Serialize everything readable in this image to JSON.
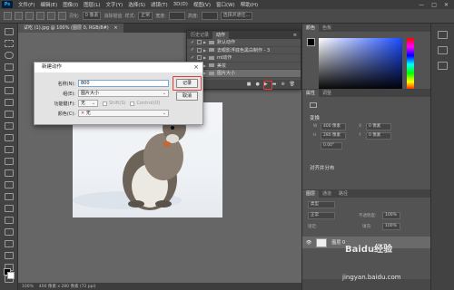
{
  "menu": {
    "logo": "Ps",
    "items": [
      "文件(F)",
      "编辑(E)",
      "图像(I)",
      "图层(L)",
      "文字(Y)",
      "选择(S)",
      "滤镜(T)",
      "3D(D)",
      "视图(V)",
      "窗口(W)",
      "帮助(H)"
    ],
    "minimize": "—",
    "maximize": "□",
    "close": "✕"
  },
  "options": {
    "feather_label": "羽化:",
    "feather_value": "0 像素",
    "antialias_label": "消除锯齿",
    "style_label": "样式:",
    "style_value": "正常",
    "width_label": "宽度:",
    "height_label": "高度:",
    "select_mask": "选择并遮住..."
  },
  "document": {
    "tab_title": "试吃 (1).jpg @ 100% (图层 0, RGB/8#)",
    "tab_close": "×",
    "zoom": "100%",
    "status": "400 像素 x 280 像素 (72 ppi)"
  },
  "dialog": {
    "title": "新建动作",
    "close": "×",
    "name_label": "名称(N):",
    "name_value": "800",
    "set_label": "组(E):",
    "set_value": "图片大小",
    "function_key_label": "功能键(F):",
    "function_key_value": "无",
    "shift_label": "Shift(S)",
    "control_label": "Control(O)",
    "color_label": "颜色(C):",
    "color_value": "无",
    "record_button": "记录",
    "cancel_button": "取消"
  },
  "actions_panel": {
    "tabs": [
      "历史记录",
      "动作"
    ],
    "collapse": "«",
    "close": "×",
    "menu_icon": "≡",
    "rows": [
      {
        "label": "默认动作",
        "expanded": false,
        "selected": false
      },
      {
        "label": "去眼影浮底色黑白制作 - 3",
        "expanded": false,
        "selected": false
      },
      {
        "label": "ml动作",
        "expanded": false,
        "selected": false
      },
      {
        "label": "美妆",
        "expanded": false,
        "selected": false
      },
      {
        "label": "图片大小",
        "expanded": false,
        "selected": true
      }
    ],
    "check": "✓",
    "footer_buttons": [
      "■",
      "●",
      "▶",
      "▬",
      "⊕",
      "🗑"
    ]
  },
  "right_panel": {
    "top_tabs": [
      "颜色",
      "色板"
    ],
    "props_tabs": [
      "属性",
      "调整"
    ],
    "transform_label": "变换",
    "w_label": "W",
    "w_value": "400 像素",
    "h_label": "H",
    "h_value": "280 像素",
    "x_label": "X",
    "x_value": "0 像素",
    "y_label": "Y",
    "y_value": "0 像素",
    "angle_value": "0.00°",
    "align_label": "对齐并分布",
    "layers_tabs": [
      "图层",
      "通道",
      "路径"
    ],
    "kind_label": "类型",
    "blend_label": "正常",
    "opacity_label": "不透明度:",
    "opacity_value": "100%",
    "lock_label": "锁定:",
    "fill_label": "填充:",
    "fill_value": "100%",
    "layer_name": "图层 0"
  },
  "watermark": {
    "brand": "Baidu经验",
    "url": "jingyan.baidu.com"
  },
  "colors": {
    "accent_red": "#e53935",
    "hue_top": "#ff0000",
    "picker_blue": "#1a4bff"
  },
  "icons": [
    "marquee-tool-icon",
    "move-tool-icon",
    "lasso-tool-icon",
    "crop-tool-icon",
    "eyedropper-icon",
    "brush-icon",
    "eraser-icon",
    "text-tool-icon",
    "hand-tool-icon",
    "zoom-tool-icon"
  ]
}
